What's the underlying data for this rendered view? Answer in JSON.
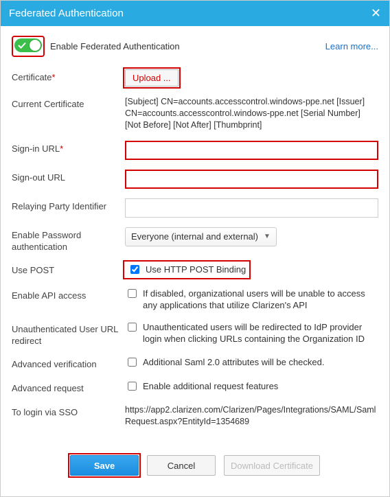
{
  "title": "Federated Authentication",
  "learn_more": "Learn more...",
  "toggle": {
    "label": "Enable Federated Authentication",
    "on": true
  },
  "cert": {
    "label": "Certificate",
    "required": true,
    "upload_label": "Upload ..."
  },
  "current_cert": {
    "label": "Current Certificate",
    "text": "[Subject] CN=accounts.accesscontrol.windows-ppe.net [Issuer] CN=accounts.accesscontrol.windows-ppe.net [Serial Number]           [Not Before]            [Not After]           [Thumbprint]"
  },
  "signin": {
    "label": "Sign-in URL",
    "required": true,
    "value": ""
  },
  "signout": {
    "label": "Sign-out URL",
    "required": false,
    "value": ""
  },
  "relay": {
    "label": "Relaying Party Identifier",
    "value": ""
  },
  "pwd_auth": {
    "label": "Enable Password authentication",
    "selected": "Everyone (internal and external)"
  },
  "use_post": {
    "label": "Use POST",
    "check_label": "Use HTTP POST Binding",
    "checked": true
  },
  "api_access": {
    "label": "Enable API access",
    "check_label": "If disabled, organizational users will be unable to access any applications that utilize Clarizen's API",
    "checked": false
  },
  "unauth_redirect": {
    "label": "Unauthenticated User URL redirect",
    "check_label": "Unauthenticated users will be redirected to IdP provider login when clicking URLs containing the Organization ID",
    "checked": false
  },
  "adv_verify": {
    "label": "Advanced verification",
    "check_label": "Additional Saml 2.0 attributes will be checked.",
    "checked": false
  },
  "adv_request": {
    "label": "Advanced request",
    "check_label": "Enable additional request features",
    "checked": false
  },
  "sso": {
    "label": "To login via SSO",
    "url": "https://app2.clarizen.com/Clarizen/Pages/Integrations/SAML/SamlRequest.aspx?EntityId=1354689"
  },
  "buttons": {
    "save": "Save",
    "cancel": "Cancel",
    "download": "Download Certificate"
  }
}
